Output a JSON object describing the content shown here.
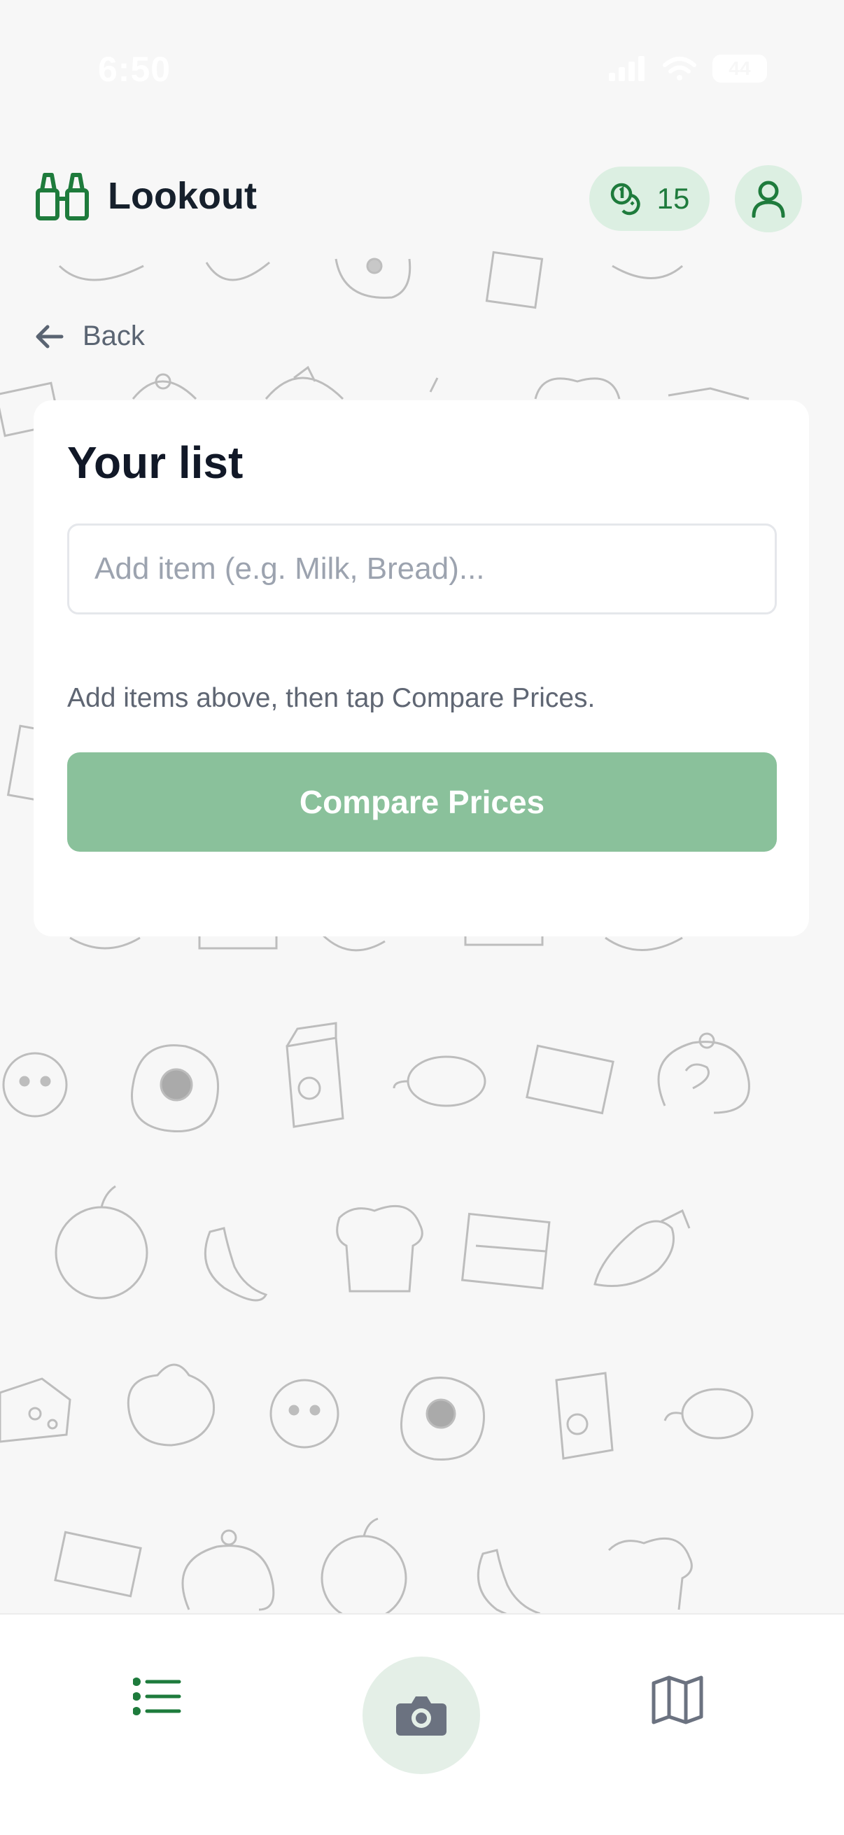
{
  "status_bar": {
    "time": "6:50",
    "battery": "44"
  },
  "header": {
    "app_name": "Lookout",
    "credits": "15"
  },
  "nav": {
    "back_label": "Back"
  },
  "card": {
    "title": "Your list",
    "input_placeholder": "Add item (e.g. Milk, Bread)...",
    "input_value": "",
    "hint": "Add items above, then tap Compare Prices.",
    "compare_button_label": "Compare Prices"
  },
  "bottom_nav": {
    "active_tab": "list"
  },
  "colors": {
    "brand_green": "#1e7b3c",
    "pill_bg": "#dcefe2",
    "compare_button": "#8ac19b",
    "page_bg": "#f7f7f7"
  },
  "icons": [
    "binoculars-icon",
    "coins-icon",
    "user-icon",
    "arrow-left-icon",
    "list-icon",
    "camera-icon",
    "map-icon"
  ]
}
